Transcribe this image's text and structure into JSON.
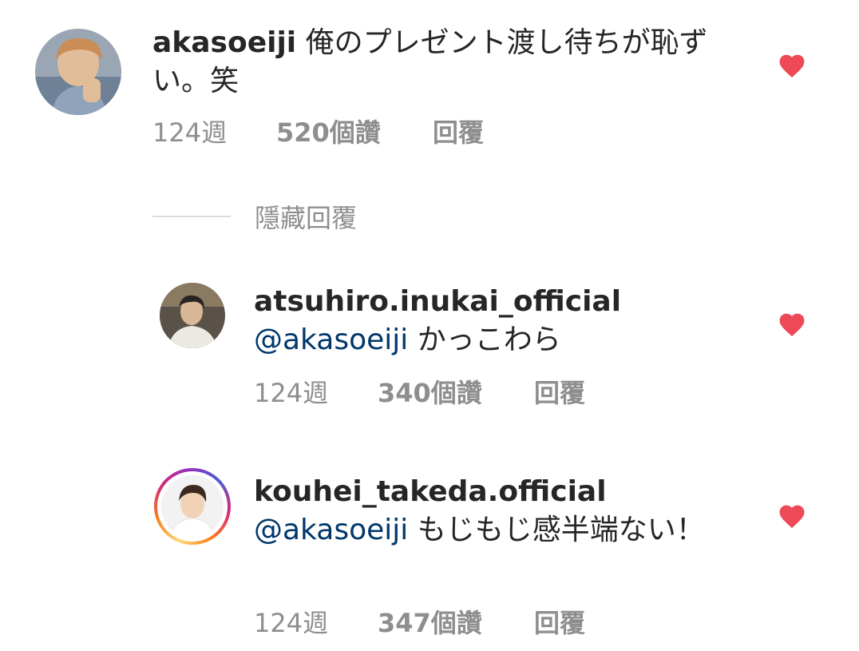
{
  "colors": {
    "heart": "#ed4956",
    "mention": "#00376b",
    "meta": "#8e8e8e",
    "text": "#262626"
  },
  "comments": [
    {
      "username": "akasoeiji",
      "mention": "",
      "text": "俺のプレゼント渡し待ちが恥ずい。笑",
      "time": "124週",
      "likes": "520個讚",
      "reply": "回覆",
      "liked": true,
      "avatar_icon": "avatar-photo"
    },
    {
      "username": "atsuhiro.inukai_official",
      "mention": "@akasoeiji",
      "text": "かっこわら",
      "time": "124週",
      "likes": "340個讚",
      "reply": "回覆",
      "liked": true,
      "avatar_icon": "avatar-photo"
    },
    {
      "username": "kouhei_takeda.official",
      "mention": "@akasoeiji",
      "text": "もじもじ感半端ない！",
      "time": "124週",
      "likes": "347個讚",
      "reply": "回覆",
      "liked": true,
      "avatar_icon": "avatar-photo-with-story-ring"
    }
  ],
  "hide_replies_label": "隱藏回覆",
  "icons": {
    "like": "heart-filled-icon"
  }
}
